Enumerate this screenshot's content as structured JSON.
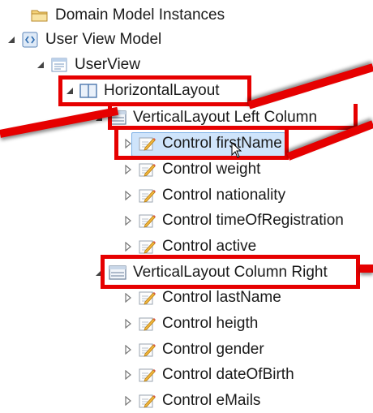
{
  "tree": {
    "root": {
      "label": "Domain Model Instances",
      "icon": "folder-icon"
    },
    "model": {
      "label": "User View Model",
      "icon": "model-icon",
      "expanded": true
    },
    "view": {
      "label": "UserView",
      "icon": "view-icon",
      "expanded": true
    },
    "horizontal": {
      "label": "HorizontalLayout",
      "icon": "horizontal-layout-icon",
      "expanded": true
    },
    "left_column": {
      "label": "VerticalLayout Left Column",
      "icon": "vertical-layout-icon",
      "expanded": true,
      "controls": [
        {
          "label": "Control firstName",
          "selected": true
        },
        {
          "label": "Control weight"
        },
        {
          "label": "Control nationality"
        },
        {
          "label": "Control timeOfRegistration"
        },
        {
          "label": "Control active"
        }
      ]
    },
    "right_column": {
      "label": "VerticalLayout Column Right",
      "icon": "vertical-layout-icon",
      "expanded": true,
      "controls": [
        {
          "label": "Control lastName"
        },
        {
          "label": "Control heigth"
        },
        {
          "label": "Control gender"
        },
        {
          "label": "Control dateOfBirth"
        },
        {
          "label": "Control eMails"
        }
      ]
    }
  },
  "colors": {
    "highlight": "#e60000",
    "selection": "#cfe4fb",
    "selection_border": "#7fb2e6",
    "text": "#1a1a1a"
  }
}
